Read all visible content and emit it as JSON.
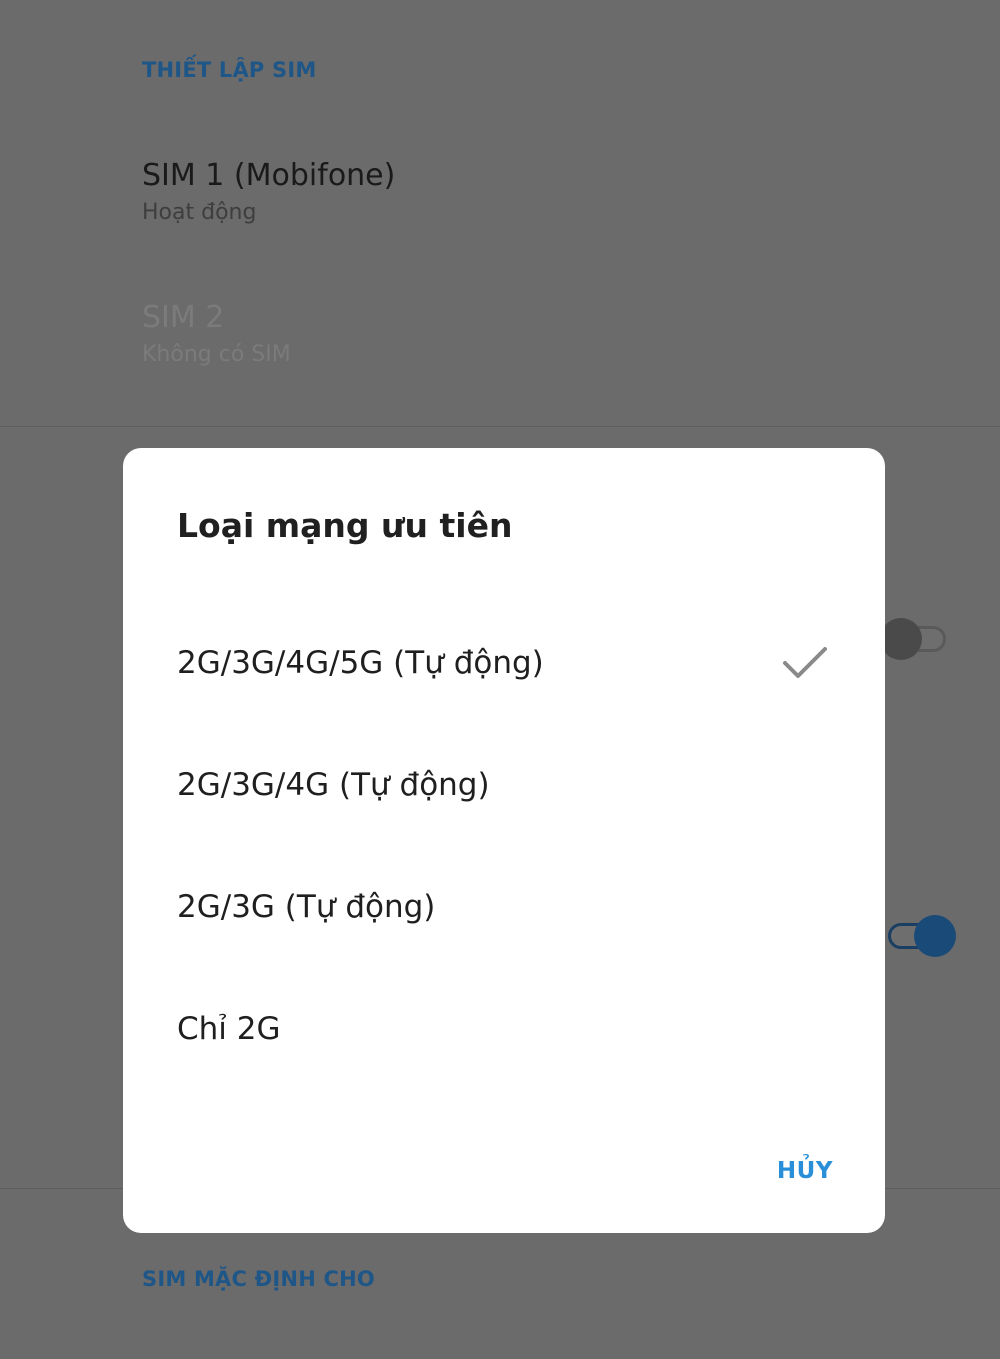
{
  "background": {
    "sim_setup_header": "THIẾT LẬP SIM",
    "sims": [
      {
        "title": "SIM 1  (Mobifone)",
        "status": "Hoạt động",
        "enabled": true
      },
      {
        "title": "SIM 2",
        "status": "Không có SIM",
        "enabled": false
      }
    ],
    "default_sim_header": "SIM MẶC ĐỊNH CHO",
    "toggles": [
      {
        "state": "off"
      },
      {
        "state": "on"
      }
    ]
  },
  "dialog": {
    "title": "Loại mạng ưu tiên",
    "options": [
      {
        "label": "2G/3G/4G/5G (Tự động)",
        "selected": true
      },
      {
        "label": "2G/3G/4G (Tự động)",
        "selected": false
      },
      {
        "label": "2G/3G (Tự động)",
        "selected": false
      },
      {
        "label": "Chỉ 2G",
        "selected": false
      }
    ],
    "cancel_label": "HỦY",
    "check_icon": "check-icon"
  },
  "colors": {
    "accent": "#2a8fd9",
    "header_blue": "#1f5688",
    "scrim": "#6b6b6b"
  }
}
